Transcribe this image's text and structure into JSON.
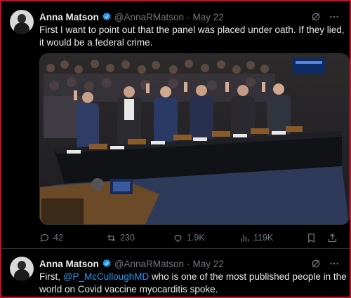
{
  "tweet1": {
    "name": "Anna Matson",
    "handle": "@AnnaRMatson",
    "sep": "·",
    "date": "May 22",
    "text": "First I want to point out that the panel was placed under oath. If they lied, it would be a federal crime.",
    "actions": {
      "replies": "42",
      "reposts": "230",
      "likes": "1.9K",
      "views": "119K"
    }
  },
  "tweet2": {
    "name": "Anna Matson",
    "handle": "@AnnaRMatson",
    "sep": "·",
    "date": "May 22",
    "text_before": "First, ",
    "mention": "@P_McCulloughMD",
    "text_after": " who is one of the most published people in the world on Covid vaccine myocarditis spoke."
  },
  "icons": [
    "verified-badge-icon",
    "grok-icon",
    "more-icon",
    "reply-icon",
    "repost-icon",
    "like-icon",
    "views-icon",
    "bookmark-icon",
    "share-icon"
  ],
  "colors": {
    "accent": "#1d9bf0",
    "muted": "#71767b",
    "border": "#c8102e"
  }
}
